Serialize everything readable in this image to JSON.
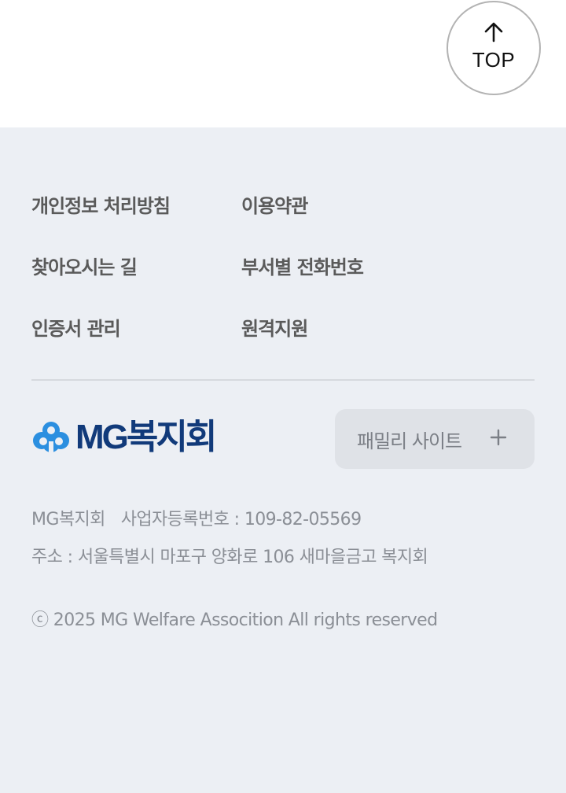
{
  "top_button": {
    "label": "TOP",
    "icon": "arrow-up-icon"
  },
  "footer": {
    "links": [
      {
        "label": "개인정보 처리방침"
      },
      {
        "label": "이용약관"
      },
      {
        "label": "찾아오시는 길"
      },
      {
        "label": "부서별 전화번호"
      },
      {
        "label": "인증서 관리"
      },
      {
        "label": "원격지원"
      }
    ],
    "logo": {
      "text": "MG복지회",
      "icon": "cloud-logo-icon",
      "colors": {
        "primary": "#113a7a",
        "accent": "#2b8fe0"
      }
    },
    "family_site": {
      "label": "패밀리 사이트",
      "icon": "plus-icon"
    },
    "company": {
      "name": "MG복지회",
      "reg_label": "사업자등록번호 : 109-82-05569",
      "address": "주소 : 서울특별시 마포구 양화로 106 새마을금고 복지회"
    },
    "copyright": "ⓒ 2025 MG Welfare Assocition All rights reserved"
  },
  "colors": {
    "footer_bg": "#eceff4",
    "link_text": "#5a5a5a",
    "info_text": "#8b8f96"
  }
}
